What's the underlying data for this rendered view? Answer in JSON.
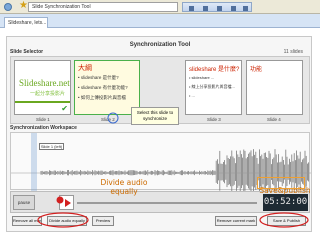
{
  "browser": {
    "title": "Slide Synchronization Tool",
    "tab_label": "Slideshare, lets..."
  },
  "app": {
    "title": "Synchronization Tool",
    "slide_selector_label": "Slide Selector",
    "slides_count": "11 slides"
  },
  "slides": [
    {
      "number": "Slide 1",
      "title": "Slideshare.net",
      "subtitle": "一起分享投影片"
    },
    {
      "number": "Slide 2",
      "title": "大綱",
      "items": [
        "• slideshare 是什麼?",
        "• slideshare 有什麼功能?",
        "• 如何上傳投影片與音檔"
      ]
    },
    {
      "number": "Slide 3",
      "title": "slideshare 是什麼?",
      "items": [
        "• slideshare ...",
        "• 線上分享投影片與音檔...",
        "• ..."
      ]
    },
    {
      "number": "Slide 4",
      "title": "功能"
    },
    {
      "number": "Slide 5"
    }
  ],
  "tooltip": "Select this slide to synchronize",
  "sync": {
    "label": "Synchronization Workspace",
    "marker_label": "Slide 1 (left)"
  },
  "player": {
    "pause_label": "pause",
    "time": "05:52:00"
  },
  "buttons": {
    "remove_all_marks": "Remove all marks",
    "divide_audio_equally": "Divide audio equally",
    "preview": "Preview",
    "remove_current_mark": "Remove current mark",
    "save_publish": "Save & Publish"
  },
  "annotations": {
    "divide": "Divide audio\nequally",
    "save": "Save&publish"
  },
  "colors": {
    "annotation_red": "#d32020",
    "annotation_orange": "#cc6b00",
    "current_slide_green": "#4bb04b"
  }
}
